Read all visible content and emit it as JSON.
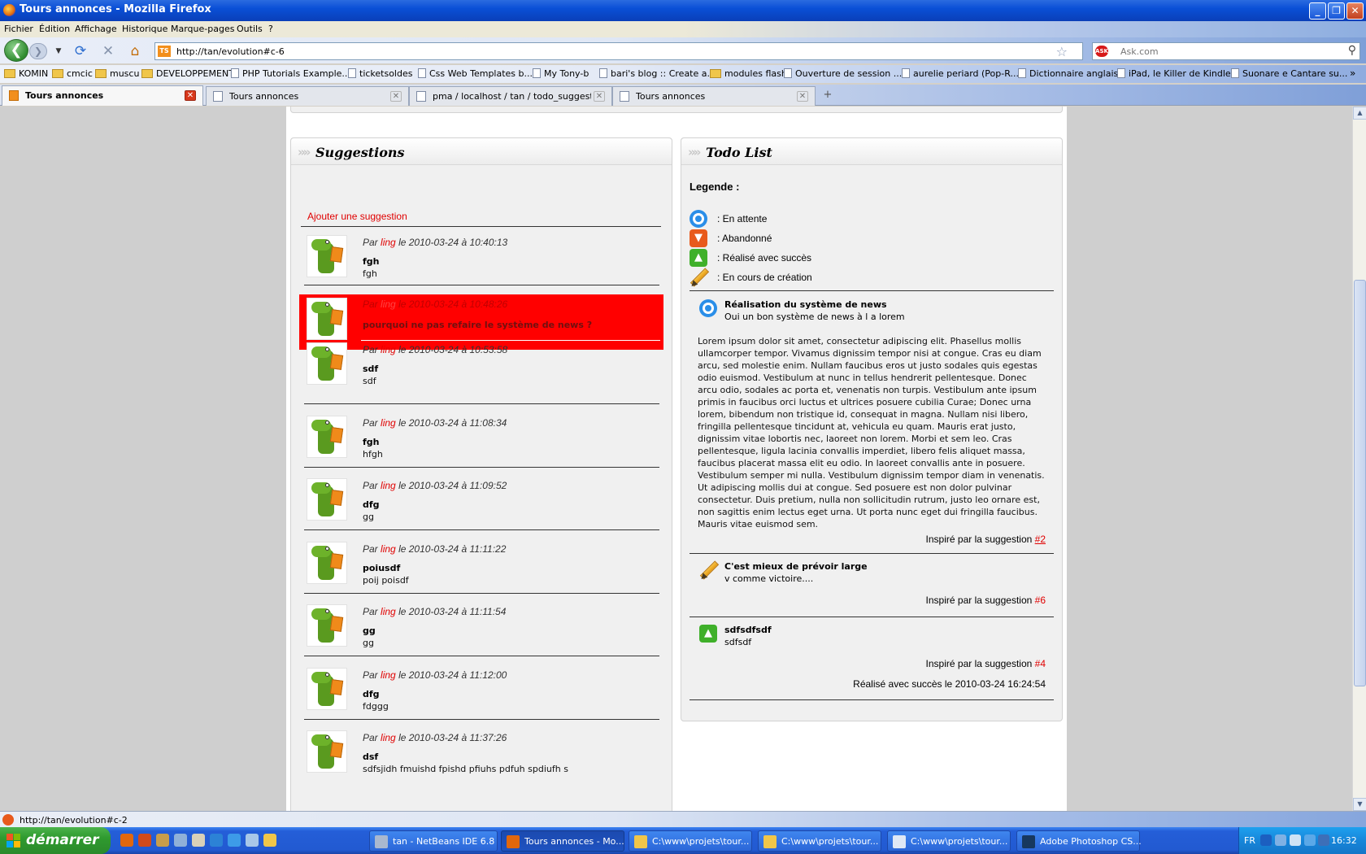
{
  "window": {
    "title": "Tours annonces - Mozilla Firefox",
    "minimize": "_",
    "maximize": "❐",
    "close": "✕"
  },
  "menu": [
    "Fichier",
    "Édition",
    "Affichage",
    "Historique",
    "Marque-pages",
    "Outils",
    "?"
  ],
  "nav": {
    "url": "http://tan/evolution#c-6",
    "url_favicon": "TS",
    "search_placeholder": "Ask.com",
    "search_engine": "ASK"
  },
  "bookmarks": [
    {
      "label": "KOMIN",
      "type": "folder"
    },
    {
      "label": "cmcic",
      "type": "folder"
    },
    {
      "label": "muscu",
      "type": "folder"
    },
    {
      "label": "DEVELOPPEMENT",
      "type": "folder"
    },
    {
      "label": "PHP Tutorials Example...",
      "type": "page"
    },
    {
      "label": "ticketsoldes",
      "type": "page"
    },
    {
      "label": "Css Web Templates b...",
      "type": "page"
    },
    {
      "label": "My Tony-b",
      "type": "page"
    },
    {
      "label": "bari's blog :: Create a...",
      "type": "page"
    },
    {
      "label": "modules flash",
      "type": "folder"
    },
    {
      "label": "Ouverture de session ...",
      "type": "page"
    },
    {
      "label": "aurelie periard (Pop-R...",
      "type": "page"
    },
    {
      "label": "Dictionnaire anglais",
      "type": "page"
    },
    {
      "label": "iPad, le Killer de Kindle...",
      "type": "page"
    },
    {
      "label": "Suonare e Cantare su...",
      "type": "page"
    }
  ],
  "tabs": [
    {
      "label": "Tours annonces",
      "active": true
    },
    {
      "label": "Tours annonces",
      "active": false
    },
    {
      "label": "pma / localhost / tan / todo_suggestion...",
      "active": false
    },
    {
      "label": "Tours annonces",
      "active": false
    }
  ],
  "suggestions": {
    "title": "Suggestions",
    "add_link": "Ajouter une suggestion",
    "by_prefix": "Par",
    "on_word": "le",
    "items": [
      {
        "author": "ling",
        "datetime": "2010-03-24 à 10:40:13",
        "title": "fgh",
        "body": "fgh",
        "highlight": false
      },
      {
        "author": "ling",
        "datetime": "2010-03-24 à 10:48:26",
        "title": "pourquoi ne pas refaire le système de news ?",
        "body": "",
        "highlight": true
      },
      {
        "author": "ling",
        "datetime": "2010-03-24 à 10:53:58",
        "title": "sdf",
        "body": "sdf",
        "highlight": false
      },
      {
        "author": "ling",
        "datetime": "2010-03-24 à 11:08:34",
        "title": "fgh",
        "body": "hfgh",
        "highlight": false
      },
      {
        "author": "ling",
        "datetime": "2010-03-24 à 11:09:52",
        "title": "dfg",
        "body": "gg",
        "highlight": false
      },
      {
        "author": "ling",
        "datetime": "2010-03-24 à 11:11:22",
        "title": "poiusdf",
        "body": "poij poisdf",
        "highlight": false
      },
      {
        "author": "ling",
        "datetime": "2010-03-24 à 11:11:54",
        "title": "gg",
        "body": "gg",
        "highlight": false
      },
      {
        "author": "ling",
        "datetime": "2010-03-24 à 11:12:00",
        "title": "dfg",
        "body": "fdggg",
        "highlight": false
      },
      {
        "author": "ling",
        "datetime": "2010-03-24 à 11:37:26",
        "title": "dsf",
        "body": "sdfsjidh fmuishd fpishd pfiuhs pdfuh spdiufh s",
        "highlight": false
      }
    ]
  },
  "todo": {
    "title": "Todo List",
    "legend_title": "Legende :",
    "legend": [
      {
        "icon": "status-waiting-icon",
        "label": ": En attente"
      },
      {
        "icon": "status-abandoned-icon",
        "label": ": Abandonné"
      },
      {
        "icon": "status-done-icon",
        "label": ": Réalisé avec succès"
      },
      {
        "icon": "status-in-progress-icon",
        "label": ": En cours de création"
      }
    ],
    "inspired_prefix": "Inspiré par la suggestion",
    "items": [
      {
        "status": "waiting",
        "title": "Réalisation du système de news",
        "subtitle": "Oui un bon système de news à l a lorem",
        "description": "Lorem ipsum dolor sit amet, consectetur adipiscing elit. Phasellus mollis ullamcorper tempor. Vivamus dignissim tempor nisi at congue. Cras eu diam arcu, sed molestie enim. Nullam faucibus eros ut justo sodales quis egestas odio euismod. Vestibulum at nunc in tellus hendrerit pellentesque. Donec arcu odio, sodales ac porta et, venenatis non turpis. Vestibulum ante ipsum primis in faucibus orci luctus et ultrices posuere cubilia Curae; Donec urna lorem, bibendum non tristique id, consequat in magna. Nullam nisi libero, fringilla pellentesque tincidunt at, vehicula eu quam. Mauris erat justo, dignissim vitae lobortis nec, laoreet non lorem. Morbi et sem leo. Cras pellentesque, ligula lacinia convallis imperdiet, libero felis aliquet massa, faucibus placerat massa elit eu odio. In laoreet convallis ante in posuere. Vestibulum semper mi nulla. Vestibulum dignissim tempor diam in venenatis. Ut adipiscing mollis dui at congue. Sed posuere est non dolor pulvinar consectetur. Duis pretium, nulla non sollicitudin rutrum, justo leo ornare est, non sagittis enim lectus eget urna. Ut porta nunc eget dui fringilla faucibus. Mauris vitae euismod sem.",
        "suggestion_ref": "#2"
      },
      {
        "status": "in-progress",
        "title": "C'est mieux de prévoir large",
        "subtitle": "v comme victoire....",
        "suggestion_ref": "#6"
      },
      {
        "status": "done",
        "title": "sdfsdfsdf",
        "subtitle": "sdfsdf",
        "suggestion_ref": "#4",
        "done_text": "Réalisé avec succès le 2010-03-24 16:24:54"
      }
    ]
  },
  "status_bar": {
    "text": "http://tan/evolution#c-2"
  },
  "taskbar": {
    "start_label": "démarrer",
    "tasks": [
      {
        "label": "tan - NetBeans IDE 6.8",
        "active": false
      },
      {
        "label": "Tours annonces - Mo...",
        "active": true
      },
      {
        "label": "C:\\www\\projets\\tour...",
        "active": false
      },
      {
        "label": "C:\\www\\projets\\tour...",
        "active": false
      },
      {
        "label": "C:\\www\\projets\\tour...",
        "active": false
      },
      {
        "label": "Adobe Photoshop CS...",
        "active": false
      }
    ],
    "language": "FR",
    "clock": "16:32"
  },
  "colors": {
    "accent_red": "#e00000",
    "highlight_row": "#ff0000",
    "status_waiting": "#2a8ee8",
    "status_abandoned": "#e85a1c",
    "status_done": "#3fb02a",
    "status_in_progress": "#f0b830"
  }
}
